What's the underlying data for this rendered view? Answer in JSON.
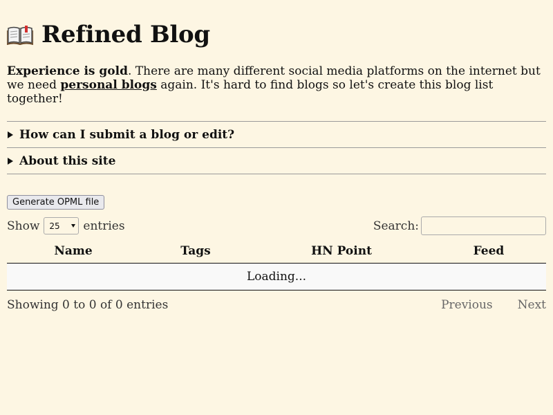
{
  "header": {
    "icon": "open-book-icon",
    "title": "Refined Blog"
  },
  "intro": {
    "bold_lead": "Experience is gold",
    "text_before_link": ". There are many different social media platforms on the internet but we need ",
    "link_text": "personal blogs",
    "text_after_link": " again. It's hard to find blogs so let's create this blog list together!"
  },
  "details": [
    {
      "summary": "How can I submit a blog or edit?"
    },
    {
      "summary": "About this site"
    }
  ],
  "opml_button": "Generate OPML file",
  "length_control": {
    "label_before": "Show",
    "selected": "25",
    "label_after": "entries"
  },
  "search": {
    "label": "Search:",
    "value": ""
  },
  "table": {
    "columns": [
      "Name",
      "Tags",
      "HN Point",
      "Feed"
    ],
    "loading_text": "Loading..."
  },
  "info": {
    "text": "Showing 0 to 0 of 0 entries"
  },
  "pagination": {
    "previous": "Previous",
    "next": "Next"
  },
  "colors": {
    "background": "#fdf6e3",
    "text": "#111111",
    "muted": "#666666"
  }
}
